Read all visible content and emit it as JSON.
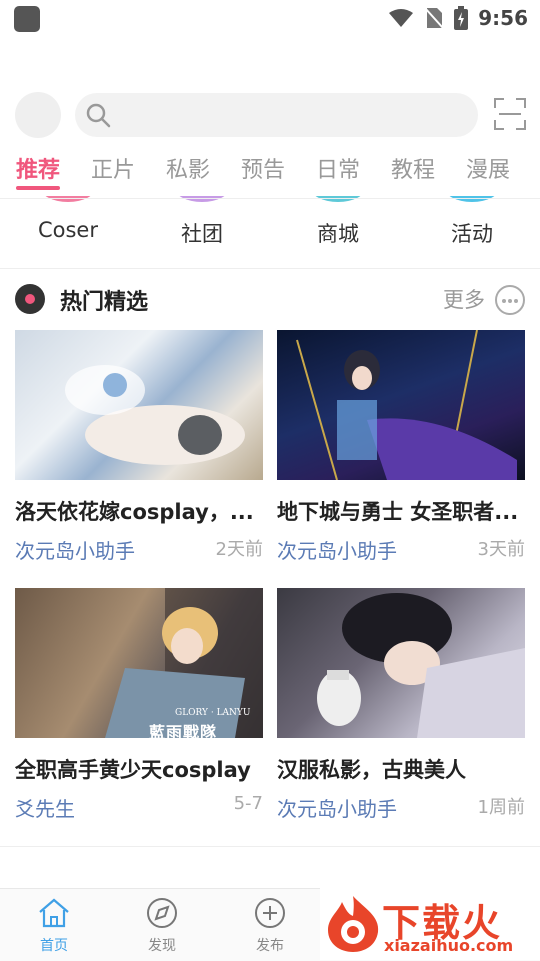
{
  "status_bar": {
    "time": "9:56"
  },
  "tabs": [
    {
      "label": "推荐",
      "active": true
    },
    {
      "label": "正片"
    },
    {
      "label": "私影"
    },
    {
      "label": "预告"
    },
    {
      "label": "日常"
    },
    {
      "label": "教程"
    },
    {
      "label": "漫展"
    }
  ],
  "categories": [
    {
      "label": "Coser",
      "color": "#f27da0"
    },
    {
      "label": "社团",
      "color": "#c79be6"
    },
    {
      "label": "商城",
      "color": "#5ec9d8"
    },
    {
      "label": "活动",
      "color": "#4fc3e8"
    }
  ],
  "section": {
    "title": "热门精选",
    "more": "更多"
  },
  "cards": [
    {
      "title": "洛天依花嫁cosplay，...",
      "author": "次元岛小助手",
      "time": "2天前"
    },
    {
      "title": "地下城与勇士 女圣职者...",
      "author": "次元岛小助手",
      "time": "3天前"
    },
    {
      "title": "全职高手黄少天cosplay",
      "author": "爻先生",
      "time": "5-7",
      "overlay": "GLORY · LANYU",
      "overlay2": "藍雨戰隊"
    },
    {
      "title": "汉服私影，古典美人",
      "author": "次元岛小助手",
      "time": "1周前"
    }
  ],
  "bottom_nav": [
    {
      "label": "首页",
      "icon": "home-icon",
      "active": true
    },
    {
      "label": "发现",
      "icon": "compass-icon"
    },
    {
      "label": "发布",
      "icon": "plus-circle-icon"
    }
  ],
  "watermark": {
    "brand": "下载火",
    "url": "xiazaihuo.com"
  },
  "colors": {
    "accent": "#f0577d",
    "link": "#5b7bb5",
    "nav_active": "#3fa0e6"
  }
}
